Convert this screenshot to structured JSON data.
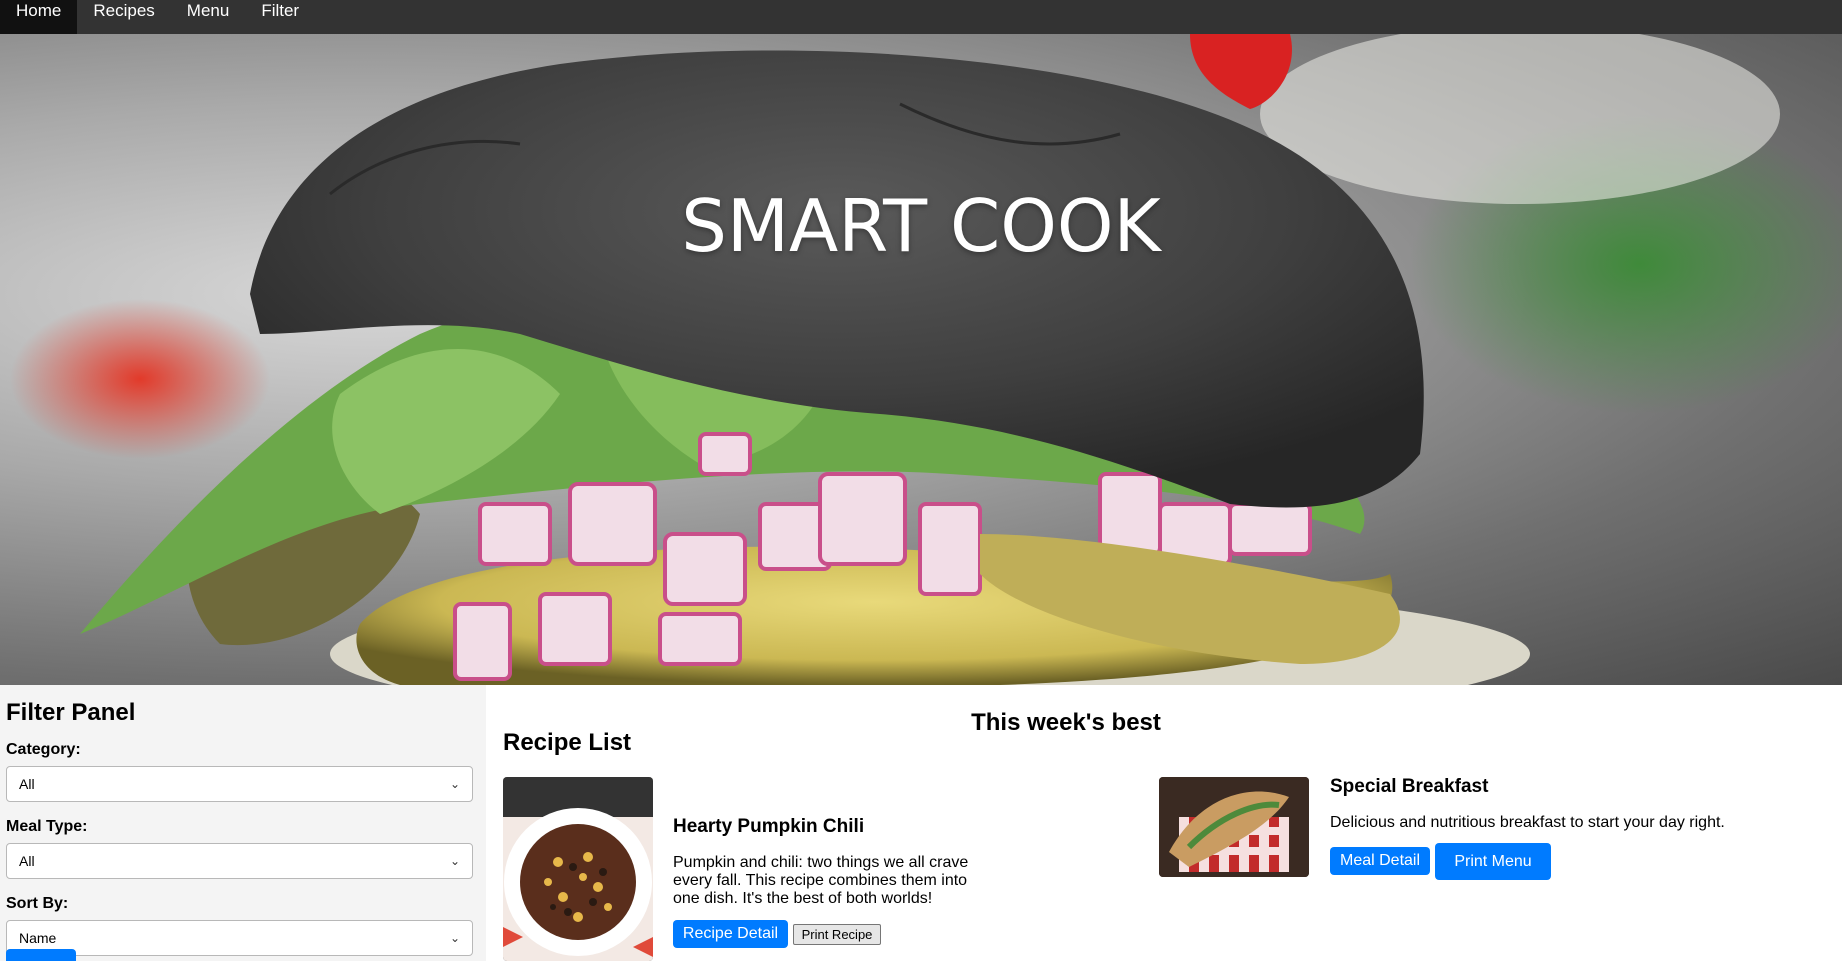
{
  "nav": {
    "items": [
      {
        "label": "Home",
        "active": true
      },
      {
        "label": "Recipes",
        "active": false
      },
      {
        "label": "Menu",
        "active": false
      },
      {
        "label": "Filter",
        "active": false
      }
    ]
  },
  "hero": {
    "title": "SMART COOK"
  },
  "filter_panel": {
    "title": "Filter Panel",
    "category_label": "Category:",
    "category_value": "All",
    "meal_type_label": "Meal Type:",
    "meal_type_value": "All",
    "sort_label": "Sort By:",
    "sort_value": "Name"
  },
  "main": {
    "section_title": "This week's best",
    "recipe_list_title": "Recipe List",
    "recipe_card": {
      "title": "Hearty Pumpkin Chili",
      "description": "Pumpkin and chili: two things we all crave every fall. This recipe combines them into one dish. It's the best of both worlds!",
      "detail_button": "Recipe Detail",
      "print_button": "Print Recipe"
    },
    "menu_card": {
      "title": "Special Breakfast",
      "description": "Delicious and nutritious breakfast to start your day right.",
      "detail_button": "Meal Detail",
      "print_button": "Print Menu"
    }
  },
  "colors": {
    "nav_bg": "#333333",
    "nav_active": "#111111",
    "primary": "#007bff"
  }
}
